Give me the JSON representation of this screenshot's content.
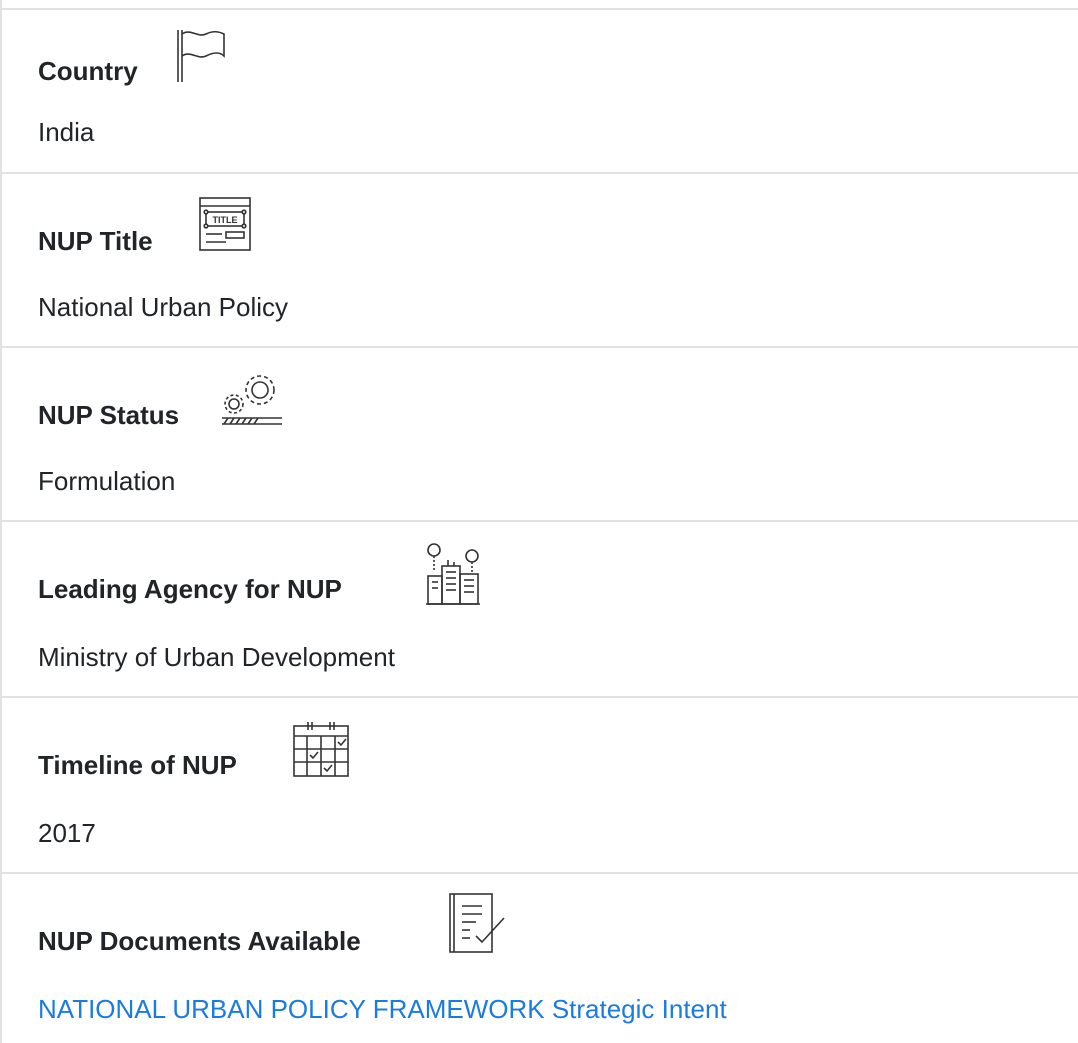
{
  "fields": [
    {
      "label": "Country",
      "value": "India",
      "icon": "flag-icon"
    },
    {
      "label": "NUP Title",
      "value": "National Urban Policy",
      "icon": "title-window-icon"
    },
    {
      "label": "NUP Status",
      "value": "Formulation",
      "icon": "gears-progress-icon"
    },
    {
      "label": "Leading Agency for NUP",
      "value": "Ministry of Urban Development",
      "icon": "city-agency-icon"
    },
    {
      "label": "Timeline of NUP",
      "value": "2017",
      "icon": "calendar-icon"
    },
    {
      "label": "NUP Documents Available",
      "value": "NATIONAL URBAN POLICY FRAMEWORK Strategic Intent",
      "icon": "document-check-icon"
    }
  ],
  "colors": {
    "text": "#212529",
    "link": "#1a7be0",
    "divider": "#e2e2e2"
  },
  "title_icon_text": "TITLE"
}
